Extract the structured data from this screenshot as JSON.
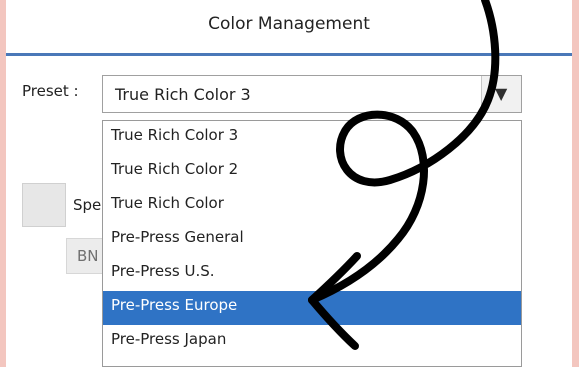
{
  "window": {
    "title": "Color Management"
  },
  "preset": {
    "label": "Preset :",
    "selected_value": "True Rich Color 3",
    "dropdown_arrow": "▼",
    "options": [
      {
        "label": "True Rich Color 3"
      },
      {
        "label": "True Rich Color 2"
      },
      {
        "label": "True Rich Color"
      },
      {
        "label": "Pre-Press General"
      },
      {
        "label": "Pre-Press U.S."
      },
      {
        "label": "Pre-Press Europe",
        "highlighted": true
      },
      {
        "label": "Pre-Press Japan"
      }
    ]
  },
  "background": {
    "partial_label": "Spe",
    "partial_button_text": "BN"
  },
  "colors": {
    "page_bg": "#f3c6bf",
    "accent": "#4a78b8",
    "highlight": "#2f73c5",
    "annotation": "#000000"
  },
  "icons": {
    "dropdown": "chevron-down-icon",
    "annotation": "swirl-arrow-icon"
  }
}
